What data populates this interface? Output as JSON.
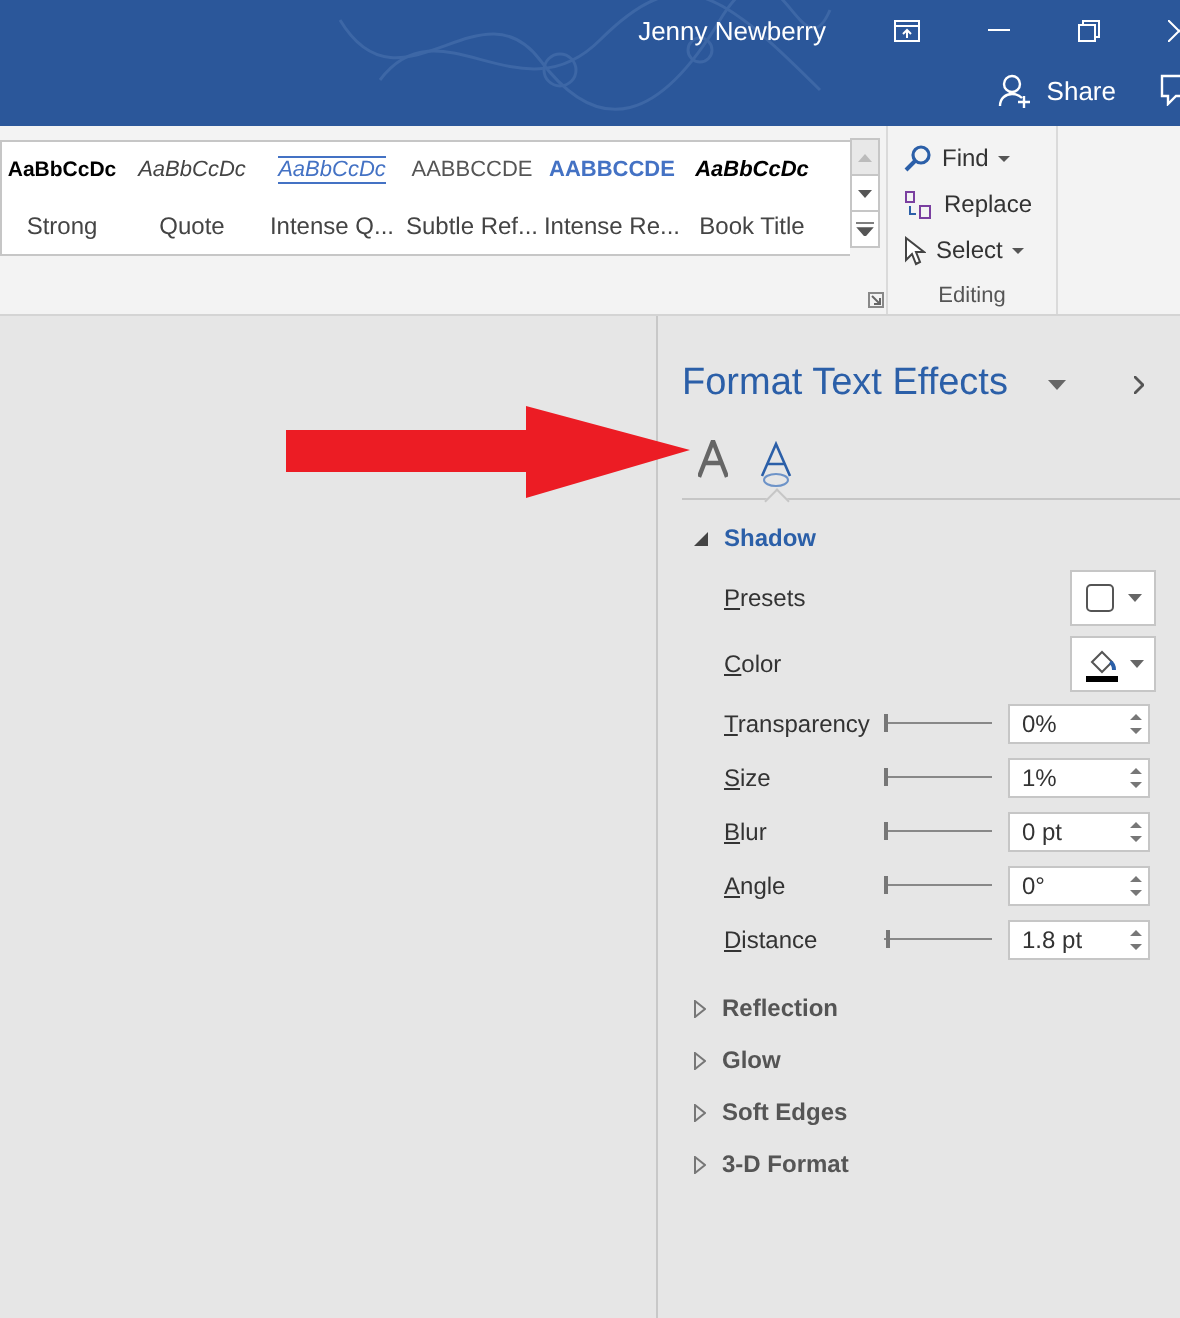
{
  "title_bar": {
    "user": "Jenny Newberry",
    "share": "Share"
  },
  "styles_gallery": [
    {
      "sample": "AaBbCcDc",
      "label": "Strong",
      "kind": "strong"
    },
    {
      "sample": "AaBbCcDc",
      "label": "Quote",
      "kind": "quote"
    },
    {
      "sample": "AaBbCcDc",
      "label": "Intense Q...",
      "kind": "intense-quote"
    },
    {
      "sample": "AABBCCDE",
      "label": "Subtle Ref...",
      "kind": "subtle-ref"
    },
    {
      "sample": "AABBCCDE",
      "label": "Intense Re...",
      "kind": "intense-ref"
    },
    {
      "sample": "AaBbCcDc",
      "label": "Book Title",
      "kind": "book-title"
    }
  ],
  "editing": {
    "items": [
      {
        "label": "Find",
        "kind": "find"
      },
      {
        "label": "Replace",
        "kind": "replace"
      },
      {
        "label": "Select",
        "kind": "select"
      }
    ],
    "group_label": "Editing"
  },
  "pane": {
    "title": "Format Text Effects",
    "tabs": [
      {
        "kind": "fill",
        "selected": false
      },
      {
        "kind": "effects",
        "selected": true
      }
    ],
    "sections": [
      {
        "title": "Shadow",
        "expanded": true,
        "rows": [
          {
            "label": "Presets",
            "kind": "presets"
          },
          {
            "label": "Color",
            "kind": "color"
          },
          {
            "label": "Transparency",
            "kind": "slider",
            "level": 0,
            "value": "0%"
          },
          {
            "label": "Size",
            "kind": "slider",
            "level": 0,
            "value": "1%"
          },
          {
            "label": "Blur",
            "kind": "slider",
            "level": 0,
            "value": "0 pt"
          },
          {
            "label": "Angle",
            "kind": "slider",
            "level": 0,
            "value": "0°"
          },
          {
            "label": "Distance",
            "kind": "slider",
            "level": 0.02,
            "value": "1.8 pt"
          }
        ]
      },
      {
        "title": "Reflection",
        "expanded": false
      },
      {
        "title": "Glow",
        "expanded": false
      },
      {
        "title": "Soft Edges",
        "expanded": false
      },
      {
        "title": "3-D Format",
        "expanded": false
      }
    ]
  }
}
